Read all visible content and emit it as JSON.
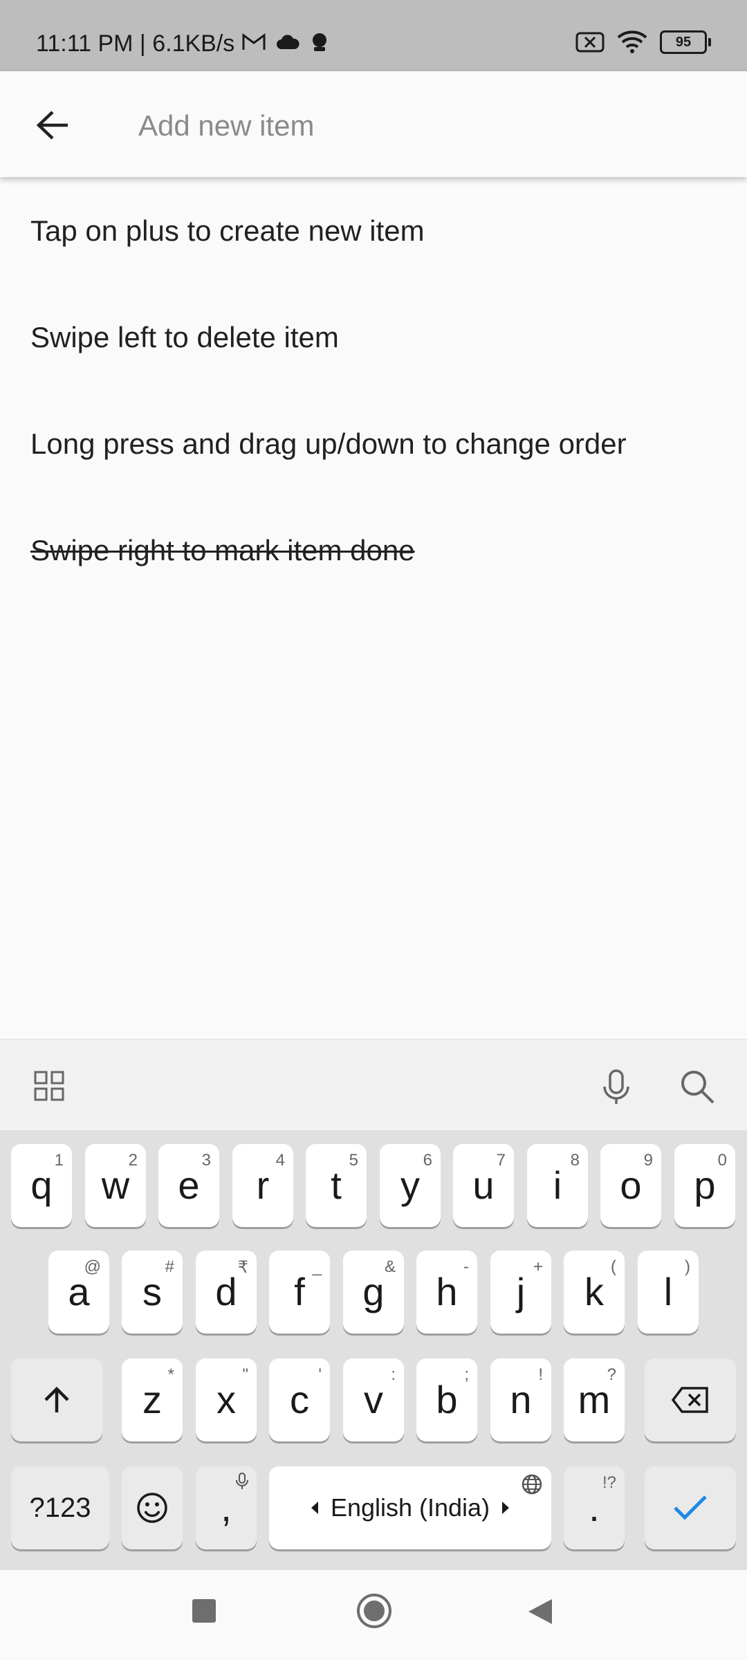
{
  "status": {
    "time_speed": "11:11 PM | 6.1KB/s",
    "battery": "95"
  },
  "appbar": {
    "input_placeholder": "Add new item"
  },
  "list": {
    "items": [
      {
        "text": "Tap on plus to create new item",
        "done": false
      },
      {
        "text": "Swipe left to delete item",
        "done": false
      },
      {
        "text": "Long press and drag up/down to change order",
        "done": false
      },
      {
        "text": "Swipe right to mark item done",
        "done": true
      }
    ]
  },
  "keyboard": {
    "row1": [
      {
        "key": "q",
        "hint": "1"
      },
      {
        "key": "w",
        "hint": "2"
      },
      {
        "key": "e",
        "hint": "3"
      },
      {
        "key": "r",
        "hint": "4"
      },
      {
        "key": "t",
        "hint": "5"
      },
      {
        "key": "y",
        "hint": "6"
      },
      {
        "key": "u",
        "hint": "7"
      },
      {
        "key": "i",
        "hint": "8"
      },
      {
        "key": "o",
        "hint": "9"
      },
      {
        "key": "p",
        "hint": "0"
      }
    ],
    "row2": [
      {
        "key": "a",
        "hint": "@"
      },
      {
        "key": "s",
        "hint": "#"
      },
      {
        "key": "d",
        "hint": "₹"
      },
      {
        "key": "f",
        "hint": "_"
      },
      {
        "key": "g",
        "hint": "&"
      },
      {
        "key": "h",
        "hint": "-"
      },
      {
        "key": "j",
        "hint": "+"
      },
      {
        "key": "k",
        "hint": "("
      },
      {
        "key": "l",
        "hint": ")"
      }
    ],
    "row3": [
      {
        "key": "z",
        "hint": "*"
      },
      {
        "key": "x",
        "hint": "\""
      },
      {
        "key": "c",
        "hint": "'"
      },
      {
        "key": "v",
        "hint": ":"
      },
      {
        "key": "b",
        "hint": ";"
      },
      {
        "key": "n",
        "hint": "!"
      },
      {
        "key": "m",
        "hint": "?"
      }
    ],
    "symbols_key": "?123",
    "comma_key": ",",
    "space_label": "English (India)",
    "period_key": ".",
    "period_hint": "!?"
  },
  "colors": {
    "accent": "#1e88e5",
    "status_bar_bg": "#bdbdbd",
    "keyboard_bg": "#e0e0e0"
  }
}
